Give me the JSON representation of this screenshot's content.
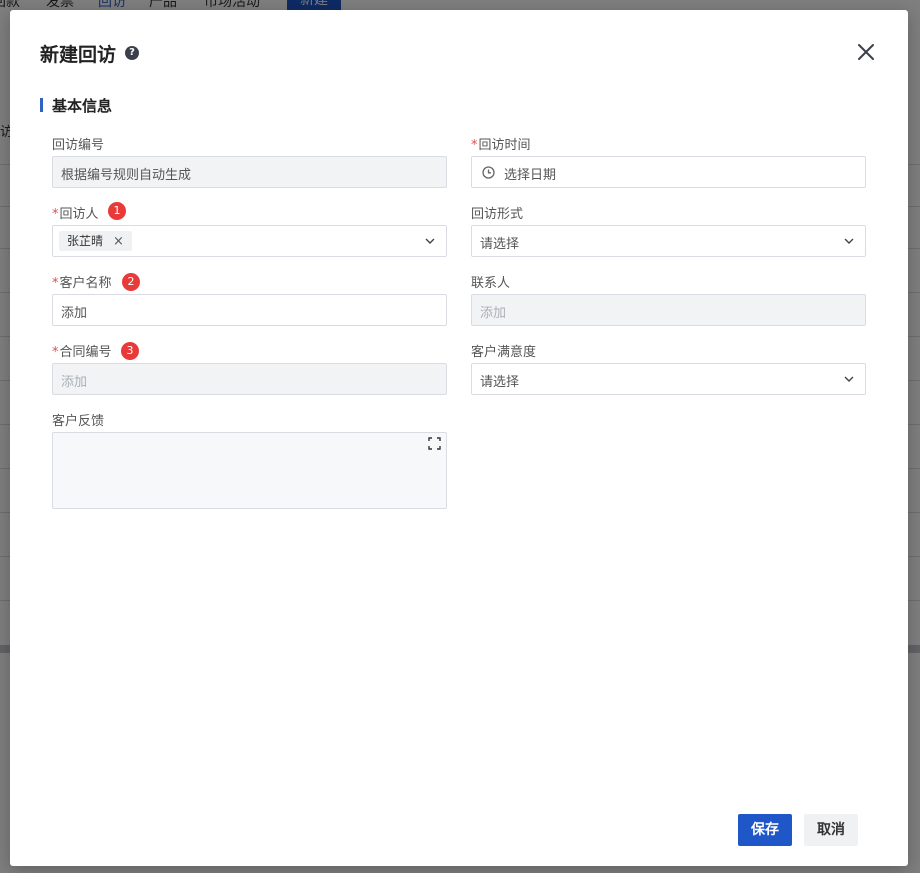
{
  "background": {
    "nav": [
      "回款",
      "发票",
      "回访",
      "产品",
      "市场活动"
    ],
    "new_button": "新建",
    "side_text": "访"
  },
  "dialog": {
    "title": "新建回访",
    "section_title": "基本信息",
    "fields": {
      "visit_number": {
        "label": "回访编号",
        "placeholder": "根据编号规则自动生成"
      },
      "visit_time": {
        "required_mark": "*",
        "label": "回访时间",
        "placeholder": "选择日期"
      },
      "visitor": {
        "required_mark": "*",
        "label": "回访人",
        "badge": "1",
        "tag": "张芷晴",
        "tag_close": "×"
      },
      "visit_form": {
        "label": "回访形式",
        "placeholder": "请选择"
      },
      "customer_name": {
        "required_mark": "*",
        "label": "客户名称",
        "badge": "2",
        "placeholder": "添加"
      },
      "contact": {
        "label": "联系人",
        "placeholder": "添加"
      },
      "contract_number": {
        "required_mark": "*",
        "label": "合同编号",
        "badge": "3",
        "placeholder": "添加"
      },
      "satisfaction": {
        "label": "客户满意度",
        "placeholder": "请选择"
      },
      "feedback": {
        "label": "客户反馈"
      }
    },
    "buttons": {
      "save": "保存",
      "cancel": "取消"
    },
    "help_icon_glyph": "?",
    "accent_color": "#1f57c8",
    "badge_color": "#e93a3a",
    "icons": [
      "help-icon",
      "close-icon",
      "clock-icon",
      "chevron-down-icon",
      "expand-icon"
    ]
  }
}
